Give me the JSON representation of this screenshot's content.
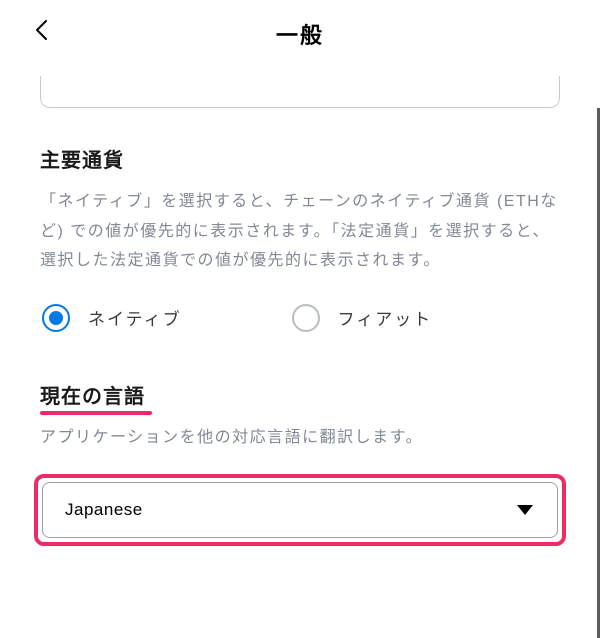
{
  "header": {
    "title": "一般"
  },
  "primaryCurrency": {
    "title": "主要通貨",
    "description": "「ネイティブ」を選択すると、チェーンのネイティブ通貨 (ETHなど) での値が優先的に表示されます。「法定通貨」を選択すると、選択した法定通貨での値が優先的に表示されます。",
    "options": {
      "native": "ネイティブ",
      "fiat": "フィアット"
    }
  },
  "language": {
    "title": "現在の言語",
    "description": "アプリケーションを他の対応言語に翻訳します。",
    "selected": "Japanese"
  }
}
